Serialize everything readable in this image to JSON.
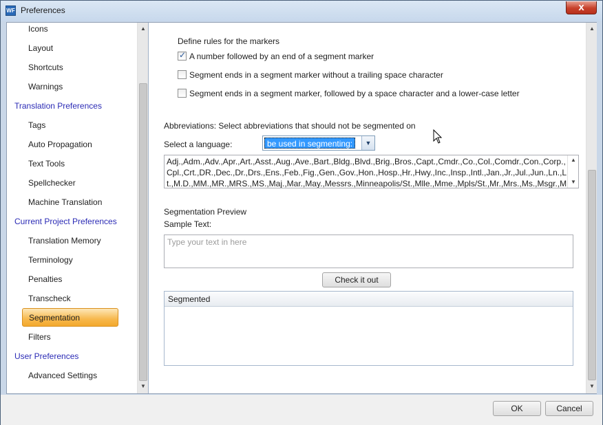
{
  "window": {
    "title": "Preferences",
    "app_icon": "WF",
    "close_glyph": "x",
    "colors": {
      "titlebar": "#c7d8ec",
      "close": "#c7402a",
      "selected_nav": "#f7b84c",
      "header_link": "#2a2ab5"
    }
  },
  "sidebar": {
    "items": [
      {
        "label": "Icons",
        "type": "child"
      },
      {
        "label": "Layout",
        "type": "child"
      },
      {
        "label": "Shortcuts",
        "type": "child"
      },
      {
        "label": "Warnings",
        "type": "child"
      },
      {
        "label": "Translation Preferences",
        "type": "header"
      },
      {
        "label": "Tags",
        "type": "child"
      },
      {
        "label": "Auto Propagation",
        "type": "child"
      },
      {
        "label": "Text Tools",
        "type": "child"
      },
      {
        "label": "Spellchecker",
        "type": "child"
      },
      {
        "label": "Machine Translation",
        "type": "child"
      },
      {
        "label": "Current Project Preferences",
        "type": "header"
      },
      {
        "label": "Translation Memory",
        "type": "child"
      },
      {
        "label": "Terminology",
        "type": "child"
      },
      {
        "label": "Penalties",
        "type": "child"
      },
      {
        "label": "Transcheck",
        "type": "child"
      },
      {
        "label": "Segmentation",
        "type": "child",
        "selected": true
      },
      {
        "label": "Filters",
        "type": "child"
      },
      {
        "label": "User Preferences",
        "type": "header"
      },
      {
        "label": "Advanced Settings",
        "type": "child"
      }
    ]
  },
  "markers": {
    "heading": "Define rules for the markers",
    "rules": [
      {
        "label": "A number followed by an end of a segment marker",
        "checked": true
      },
      {
        "label": "Segment ends in a segment marker without a trailing space character",
        "checked": false
      },
      {
        "label": "Segment ends in a segment marker, followed by a space character and a lower-case letter",
        "checked": false
      }
    ]
  },
  "abbreviations": {
    "heading": "Abbreviations: Select abbreviations that should not be segmented on",
    "language_label": "Select a language:",
    "language_value": "be used in segmenting:",
    "list_text": "Adj.,Adm.,Adv.,Apr.,Art.,Asst.,Aug.,Ave.,Bart.,Bldg.,Blvd.,Brig.,Bros.,Capt.,Cmdr.,Co.,Col.,Comdr.,Con.,Corp.,Cpl.,Crt.,DR.,Dec.,Dr.,Drs.,Ens.,Feb.,Fig.,Gen.,Gov.,Hon.,Hosp.,Hr.,Hwy.,Inc.,Insp.,Intl.,Jan.,Jr.,Jul.,Jun.,Ln.,Lt.,M.D.,MM.,MR.,MRS.,MS.,Maj.,Mar.,May.,Messrs.,Minneapolis/St.,Mlle.,Mme.,Mpls/St.,Mr.,Mrs.,Ms.,Msgr.,Mt.,No.,Nos.,Nov.,Oct.,Op.,Ord.,Pfc.,Ph.,Prof.,Pvt.,Rd.,Rep.,Reps.,Res.,Rev.,Rt.,Sen.,Sens."
  },
  "preview": {
    "heading": "Segmentation Preview",
    "sample_label": "Sample Text:",
    "sample_placeholder": "Type your text in here",
    "check_button": "Check it out",
    "result_header": "Segmented"
  },
  "footer": {
    "ok_button": "OK",
    "cancel_button": "Cancel"
  },
  "icons": {
    "scroll_up": "▲",
    "scroll_down": "▼",
    "dropdown": "▼",
    "checkmark": "✓"
  }
}
